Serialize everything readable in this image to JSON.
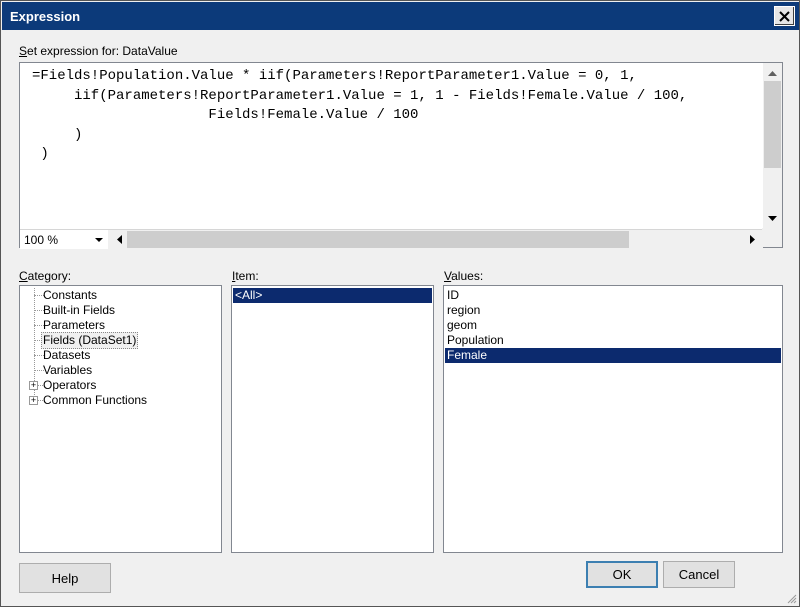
{
  "window": {
    "title": "Expression",
    "close_glyph": "✕"
  },
  "expression": {
    "label_prefix": "S",
    "label_rest": "et expression for: DataValue",
    "code": "=Fields!Population.Value * iif(Parameters!ReportParameter1.Value = 0, 1,\n     iif(Parameters!ReportParameter1.Value = 1, 1 - Fields!Female.Value / 100,\n                     Fields!Female.Value / 100\n     )\n )",
    "zoom_value": "100 %"
  },
  "category": {
    "label_prefix": "C",
    "label_rest": "ategory:",
    "items": [
      {
        "label": "Constants",
        "expandable": false
      },
      {
        "label": "Built-in Fields",
        "expandable": false
      },
      {
        "label": "Parameters",
        "expandable": false
      },
      {
        "label": "Fields (DataSet1)",
        "expandable": false,
        "selected": true
      },
      {
        "label": "Datasets",
        "expandable": false
      },
      {
        "label": "Variables",
        "expandable": false
      },
      {
        "label": "Operators",
        "expandable": true
      },
      {
        "label": "Common Functions",
        "expandable": true
      }
    ]
  },
  "item": {
    "label_prefix": "I",
    "label_rest": "tem:",
    "items": [
      {
        "label": "<All>",
        "selected": true
      }
    ]
  },
  "values": {
    "label_prefix": "V",
    "label_rest": "alues:",
    "items": [
      {
        "label": "ID",
        "selected": false
      },
      {
        "label": "region",
        "selected": false
      },
      {
        "label": "geom",
        "selected": false
      },
      {
        "label": "Population",
        "selected": false
      },
      {
        "label": "Female",
        "selected": true
      }
    ]
  },
  "buttons": {
    "help": "Help",
    "ok": "OK",
    "cancel": "Cancel"
  },
  "colors": {
    "titlebar": "#0c3a7a",
    "selection": "#0c2a6e"
  }
}
